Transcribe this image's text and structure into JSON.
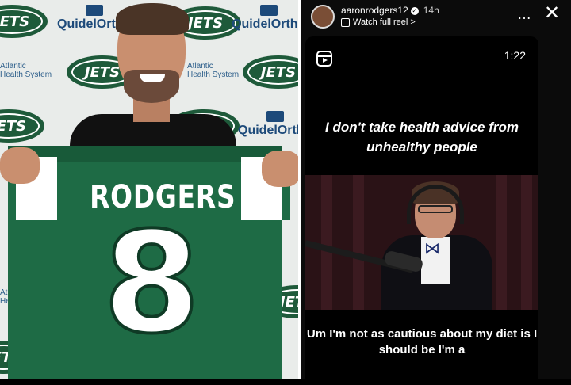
{
  "photo": {
    "backdrop": {
      "jets_logo_text": "JETS",
      "sponsor_quidel": "QuidelOrtho",
      "sponsor_atlantic_line1": "Atlantic",
      "sponsor_atlantic_line2": "Health System"
    },
    "jersey": {
      "name": "RODGERS",
      "number": "8",
      "color": "#1e6b45"
    }
  },
  "story": {
    "username": "aaronrodgers12",
    "verified_icon": "verified-badge-icon",
    "time": "14h",
    "watch_link": "Watch full reel",
    "watch_chevron": ">",
    "more_icon": "…",
    "close_icon": "✕",
    "reel": {
      "icon": "reels-icon",
      "duration": "1:22",
      "caption_top": "I don't take health advice from unhealthy people",
      "caption_bottom": "Um I'm not as cautious about my diet is I should be I'm a"
    }
  },
  "colors": {
    "jets_green": "#1e5a3a",
    "story_bg": "#0b0b0b",
    "text_light": "#ffffff"
  }
}
